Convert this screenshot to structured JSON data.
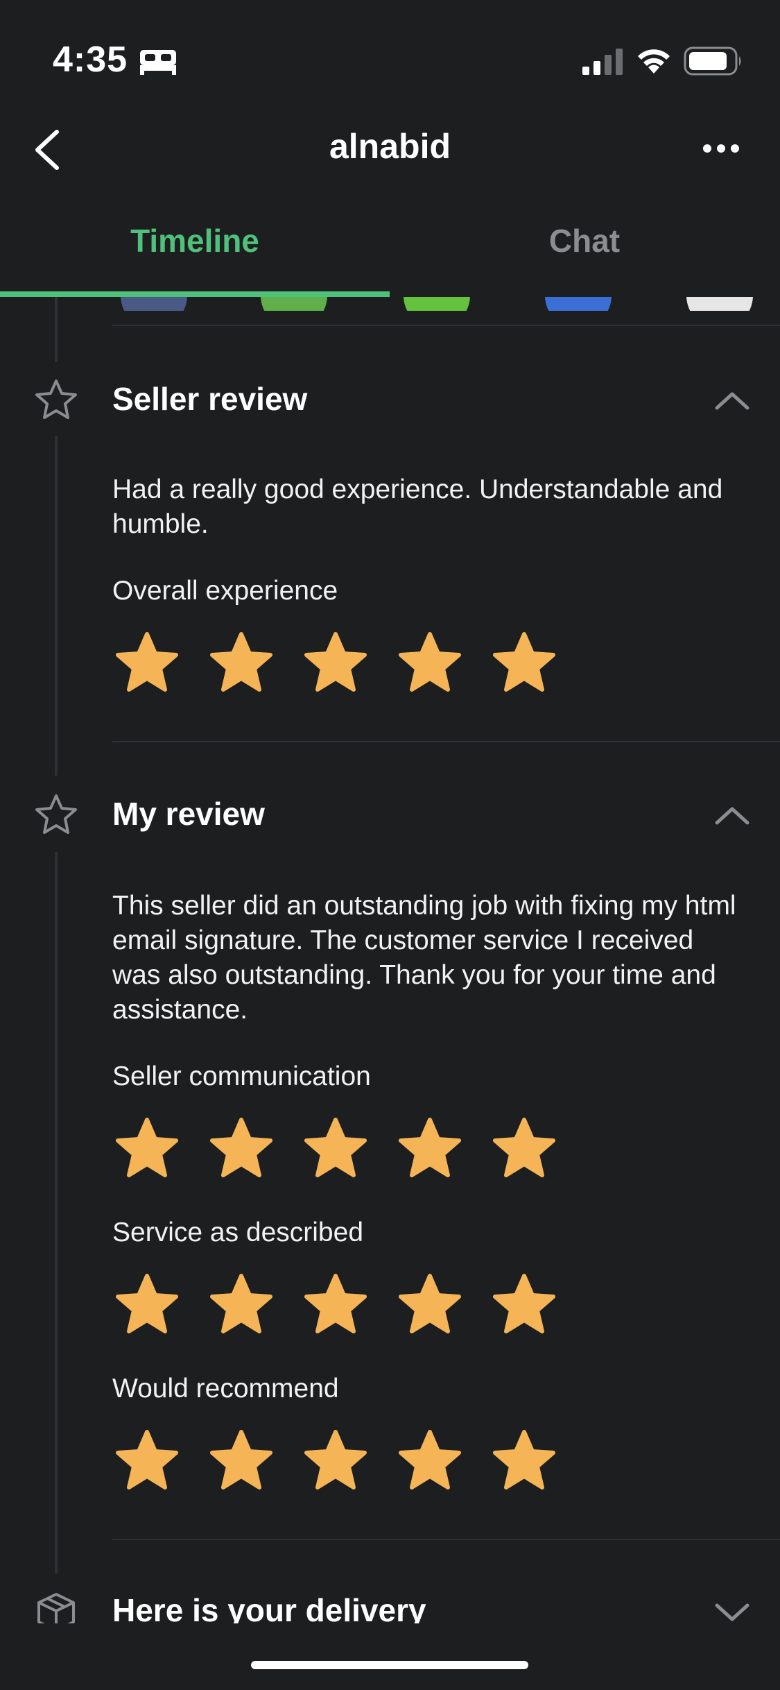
{
  "status_bar": {
    "time": "4:35"
  },
  "header": {
    "title": "alnabid"
  },
  "tabs": [
    {
      "label": "Timeline",
      "active": true
    },
    {
      "label": "Chat",
      "active": false
    }
  ],
  "colors": {
    "accent": "#4fc17a",
    "star": "#f5b556",
    "background": "#1d1e20",
    "muted": "#8b8d91"
  },
  "seller_review": {
    "title": "Seller review",
    "text": "Had a really good experience. Understandable and humble.",
    "ratings": [
      {
        "label": "Overall experience",
        "stars": 5
      }
    ]
  },
  "my_review": {
    "title": "My review",
    "text": "This seller did an outstanding job with fixing my html email signature. The customer service I received was also outstanding. Thank you for your time and assistance.",
    "ratings": [
      {
        "label": "Seller communication",
        "stars": 5
      },
      {
        "label": "Service as described",
        "stars": 5
      },
      {
        "label": "Would recommend",
        "stars": 5
      }
    ]
  },
  "delivery": {
    "title": "Here is your delivery"
  }
}
